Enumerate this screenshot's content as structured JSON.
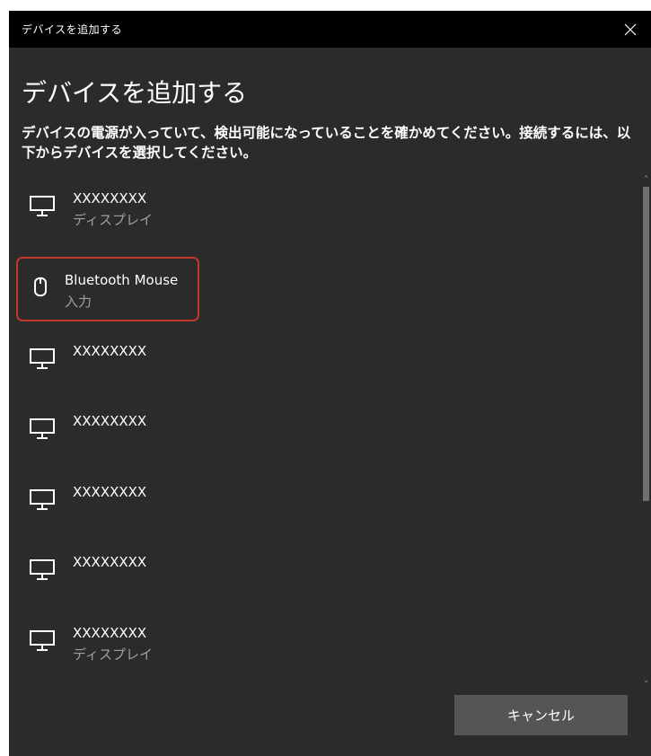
{
  "window": {
    "title": "デバイスを追加する"
  },
  "heading": "デバイスを追加する",
  "description": "デバイスの電源が入っていて、検出可能になっていることを確かめてください。接続するには、以下からデバイスを選択してください。",
  "devices": [
    {
      "name": "XXXXXXXX",
      "type": "ディスプレイ",
      "icon": "monitor-icon"
    },
    {
      "name": "Bluetooth Mouse",
      "type": "入力",
      "icon": "mouse-icon",
      "selected": true
    },
    {
      "name": "XXXXXXXX",
      "type": "",
      "icon": "monitor-icon"
    },
    {
      "name": "XXXXXXXX",
      "type": "",
      "icon": "monitor-icon"
    },
    {
      "name": "XXXXXXXX",
      "type": "",
      "icon": "monitor-icon"
    },
    {
      "name": "XXXXXXXX",
      "type": "",
      "icon": "monitor-icon"
    },
    {
      "name": "XXXXXXXX",
      "type": "ディスプレイ",
      "icon": "monitor-icon"
    }
  ],
  "buttons": {
    "cancel": "キャンセル"
  },
  "colors": {
    "background": "#2b2b2b",
    "titlebar": "#000000",
    "highlight": "#c0392b",
    "button": "#555555"
  }
}
